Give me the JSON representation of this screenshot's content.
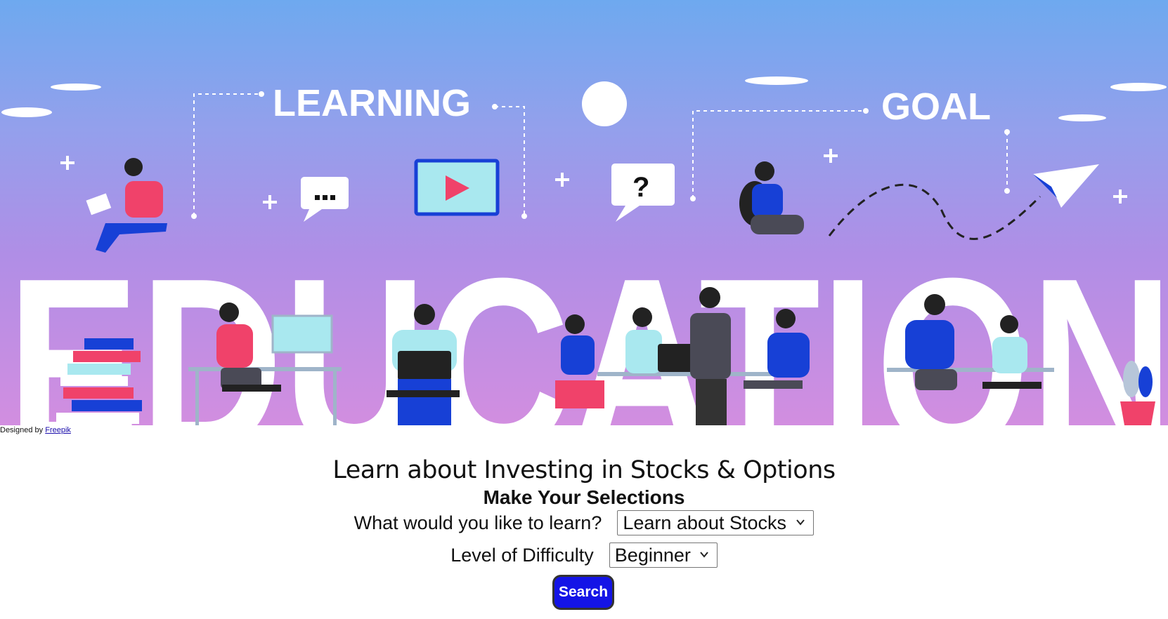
{
  "hero": {
    "word_learning": "LEARNING",
    "word_goal": "GOAL",
    "word_education": "EDUCATION"
  },
  "credit": {
    "prefix": "Designed by ",
    "link_text": "Freepik"
  },
  "main_title": "Learn about Investing in Stocks & Options",
  "sub_title": "Make Your Selections",
  "form": {
    "learn_label": "What would you like to learn?",
    "learn_value": "Learn about Stocks",
    "difficulty_label": "Level of Difficulty",
    "difficulty_value": "Beginner",
    "search_label": "Search"
  },
  "colors": {
    "search_button": "#1414e6",
    "accent_pink": "#f0426a",
    "accent_blue": "#1740d6"
  }
}
